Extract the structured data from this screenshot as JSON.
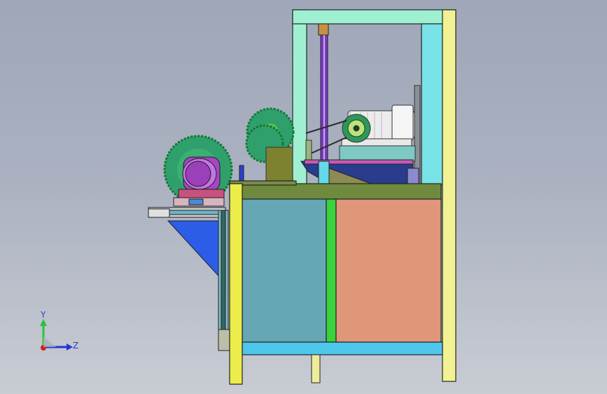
{
  "viewport": {
    "background_top": "#9fa7b8",
    "background_bottom": "#c9ccd3"
  },
  "triad": {
    "y_label": "Y",
    "z_label": "Z",
    "colors": {
      "y": "#2ec23a",
      "z": "#2136d6",
      "x": "#d42020"
    }
  },
  "model": {
    "colors": {
      "upper_frame": "#9ff0d2",
      "right_post": "#f2f294",
      "left_post": "#ecec4a",
      "bed": "#6f8a3e",
      "cabinet_left": "#66a7b5",
      "cabinet_right": "#e09679",
      "divider": "#3bd13b",
      "base_rail": "#4fc7ec",
      "lift_rod": "#7a39c6",
      "saw_blade": "#2fa06c",
      "motor_housing": "#a646c2",
      "main_motor": "#eeeeee",
      "bracket": "#2b5de6"
    }
  }
}
